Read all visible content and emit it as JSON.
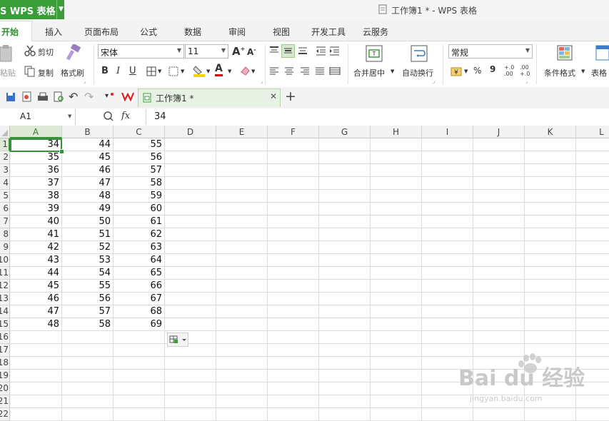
{
  "app": {
    "name": "S WPS 表格",
    "window_title": "工作簿1 * - WPS 表格"
  },
  "menu": {
    "tabs": [
      "开始",
      "插入",
      "页面布局",
      "公式",
      "数据",
      "审阅",
      "视图",
      "开发工具",
      "云服务"
    ]
  },
  "ribbon": {
    "paste_label": "粘贴",
    "cut_label": "剪切",
    "copy_label": "复制",
    "format_painter_label": "格式刷",
    "font_name": "宋体",
    "font_size": "11",
    "bold": "B",
    "italic": "I",
    "underline": "U",
    "merge_center_label": "合并居中",
    "wrap_text_label": "自动换行",
    "number_format": "常规",
    "percent": "%",
    "comma": "9",
    "conditional_format_label": "条件格式",
    "table_style_label": "表格"
  },
  "quick_access": {
    "doc_tab_label": "工作簿1 *"
  },
  "formula_bar": {
    "cell_ref": "A1",
    "fx": "fx",
    "value": "34"
  },
  "grid": {
    "columns": [
      "A",
      "B",
      "C",
      "D",
      "E",
      "F",
      "G",
      "H",
      "I",
      "J",
      "K",
      "L"
    ],
    "row_numbers": [
      "1",
      "2",
      "3",
      "4",
      "5",
      "6",
      "7",
      "8",
      "9",
      "10",
      "11",
      "12",
      "13",
      "14",
      "15",
      "16",
      "17",
      "18",
      "19",
      "20",
      "21",
      "22"
    ],
    "data": [
      [
        "34",
        "44",
        "55"
      ],
      [
        "35",
        "45",
        "56"
      ],
      [
        "36",
        "46",
        "57"
      ],
      [
        "37",
        "47",
        "58"
      ],
      [
        "38",
        "48",
        "59"
      ],
      [
        "39",
        "49",
        "60"
      ],
      [
        "40",
        "50",
        "61"
      ],
      [
        "41",
        "51",
        "62"
      ],
      [
        "42",
        "52",
        "63"
      ],
      [
        "43",
        "53",
        "64"
      ],
      [
        "44",
        "54",
        "65"
      ],
      [
        "45",
        "55",
        "66"
      ],
      [
        "46",
        "56",
        "67"
      ],
      [
        "47",
        "57",
        "68"
      ],
      [
        "48",
        "58",
        "69"
      ]
    ]
  },
  "watermark": {
    "text": "Bai du 经验",
    "url": "jingyan.baidu.com"
  },
  "colors": {
    "accent_green": "#3a9d3a",
    "selection": "#3a8f3a"
  }
}
